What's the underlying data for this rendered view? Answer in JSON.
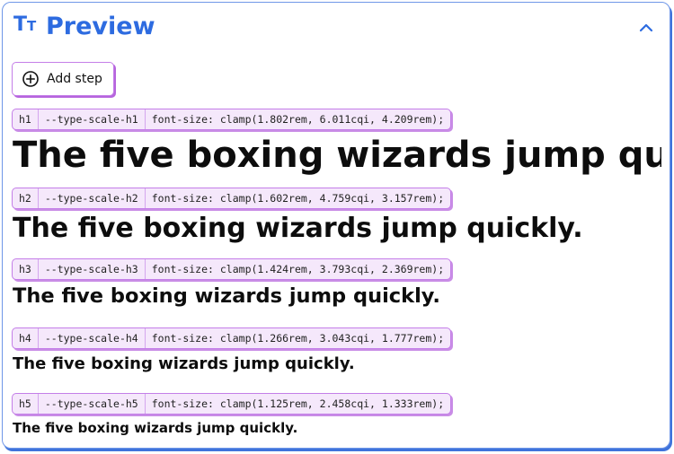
{
  "header": {
    "icon_big": "T",
    "icon_small": "T",
    "title": "Preview"
  },
  "actions": {
    "add_step_label": "Add step"
  },
  "sample_text": "The five boxing wizards jump quickly.",
  "steps": [
    {
      "tag": "h1",
      "var": "--type-scale-h1",
      "decl": "font-size: clamp(1.802rem, 6.011cqi, 4.209rem);"
    },
    {
      "tag": "h2",
      "var": "--type-scale-h2",
      "decl": "font-size: clamp(1.602rem, 4.759cqi, 3.157rem);"
    },
    {
      "tag": "h3",
      "var": "--type-scale-h3",
      "decl": "font-size: clamp(1.424rem, 3.793cqi, 2.369rem);"
    },
    {
      "tag": "h4",
      "var": "--type-scale-h4",
      "decl": "font-size: clamp(1.266rem, 3.043cqi, 1.777rem);"
    },
    {
      "tag": "h5",
      "var": "--type-scale-h5",
      "decl": "font-size: clamp(1.125rem, 2.458cqi, 1.333rem);"
    }
  ],
  "colors": {
    "accent": "#2d6be0",
    "chip_border": "#c47ee8",
    "chip_bg": "#f5e8fb"
  },
  "icons": {
    "title_icon": "type-icon",
    "collapse": "chevron-up-icon",
    "add": "plus-circle-icon"
  }
}
